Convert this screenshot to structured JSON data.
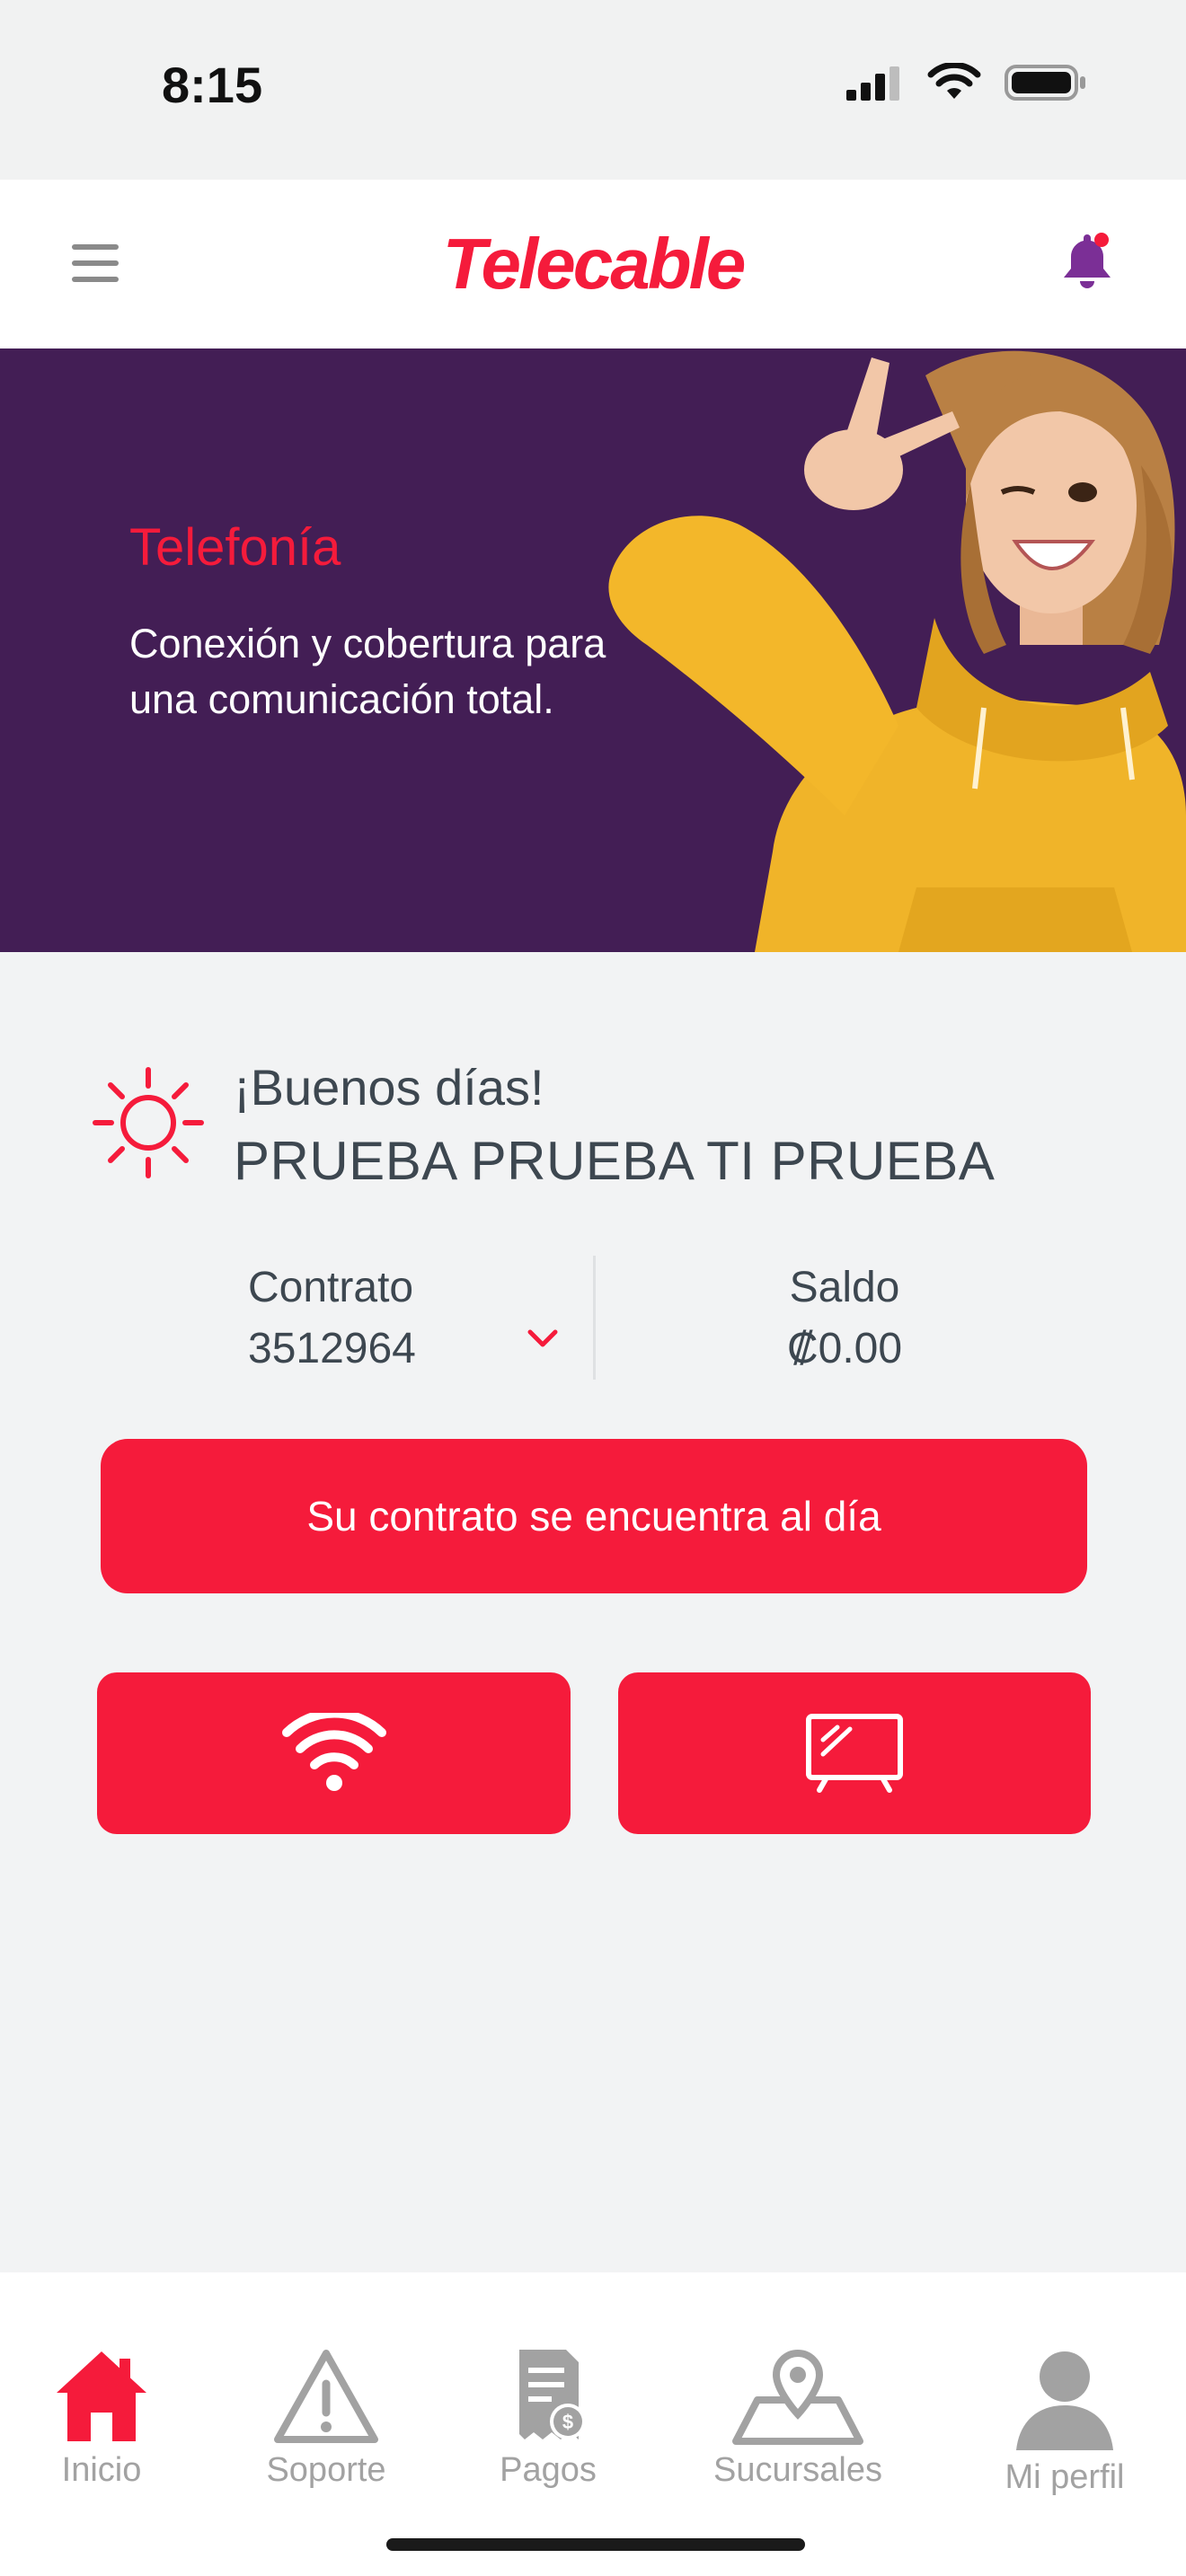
{
  "status_bar": {
    "time": "8:15",
    "icons": [
      "cellular-signal-icon",
      "wifi-icon",
      "battery-icon"
    ]
  },
  "header": {
    "brand": "Telecable",
    "menu_icon": "hamburger-menu-icon",
    "notification_icon": "bell-icon"
  },
  "banner": {
    "title": "Telefonía",
    "text": "Conexión y cobertura para una comunicación total."
  },
  "greeting": {
    "icon": "sun-icon",
    "salutation": "¡Buenos días!",
    "name": "PRUEBA PRUEBA TI PRUEBA"
  },
  "account": {
    "contract_label": "Contrato",
    "contract_number": "3512964",
    "balance_label": "Saldo",
    "balance_value": "₡0.00"
  },
  "status_button": {
    "label": "Su contrato se encuentra al día"
  },
  "services": [
    {
      "icon": "wifi-icon"
    },
    {
      "icon": "tv-icon"
    }
  ],
  "bottom_nav": [
    {
      "label": "Inicio",
      "icon": "home-icon",
      "active": true
    },
    {
      "label": "Soporte",
      "icon": "warning-icon",
      "active": false
    },
    {
      "label": "Pagos",
      "icon": "receipt-icon",
      "active": false
    },
    {
      "label": "Sucursales",
      "icon": "map-pin-icon",
      "active": false
    },
    {
      "label": "Mi perfil",
      "icon": "user-icon",
      "active": false
    }
  ],
  "colors": {
    "accent": "#f51b3b",
    "banner_bg": "#431e55",
    "bell": "#7b2f96",
    "text_dark": "#3d4750",
    "nav_inactive": "#a2a2a2"
  }
}
